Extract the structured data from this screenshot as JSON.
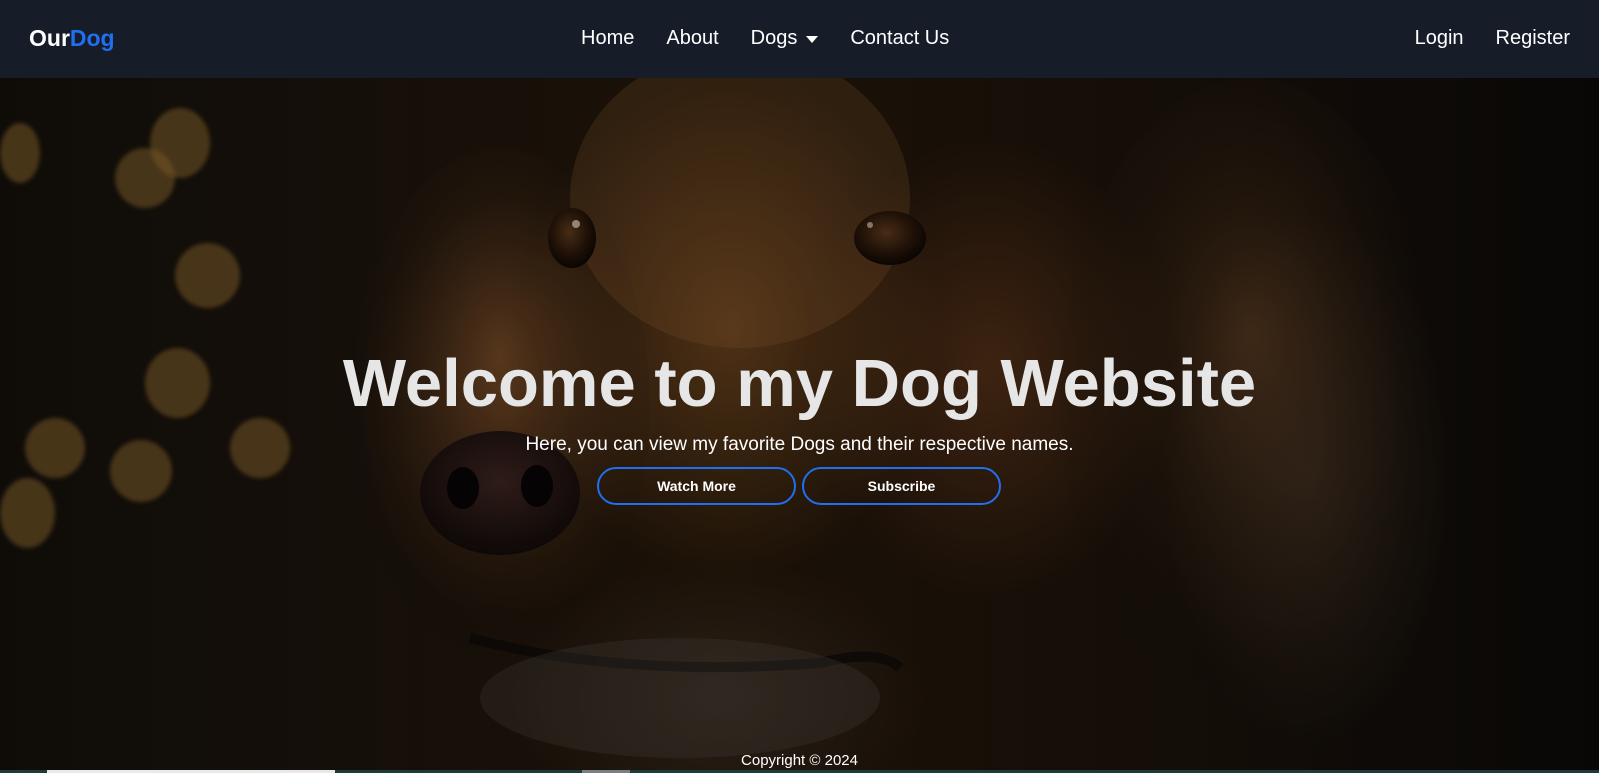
{
  "brand": {
    "part1": "Our",
    "part2": "Dog"
  },
  "nav": {
    "home": "Home",
    "about": "About",
    "dogs": "Dogs",
    "contact": "Contact Us",
    "login": "Login",
    "register": "Register"
  },
  "hero": {
    "title": "Welcome to my Dog Website",
    "subtitle": "Here, you can view my favorite Dogs and their respective names.",
    "buttons": {
      "watch_more": "Watch More",
      "subscribe": "Subscribe"
    }
  },
  "footer": {
    "copyright": "Copyright © 2024"
  },
  "icons": {
    "dropdown": "caret-down-icon"
  },
  "colors": {
    "navbar_bg": "#161d29",
    "accent": "#1f6ff0",
    "text_light": "#ffffff",
    "title_text": "#e6e6e6"
  }
}
